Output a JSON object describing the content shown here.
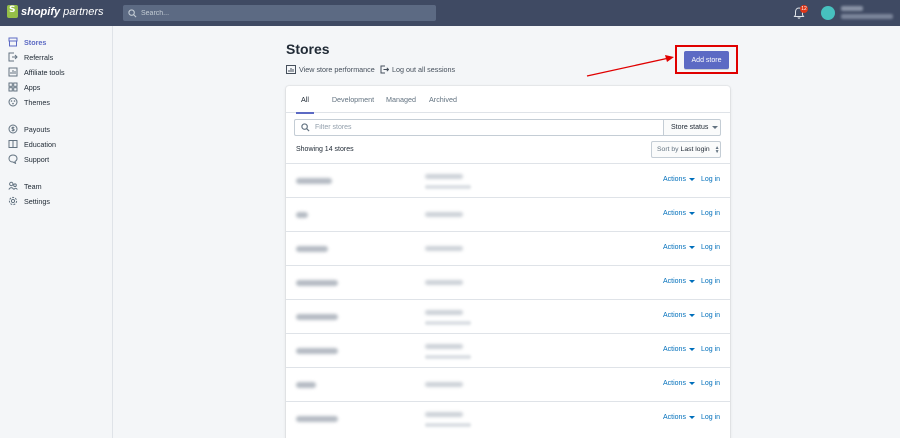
{
  "topbar": {
    "brand_bold": "shopify",
    "brand_light": " partners",
    "search_placeholder": "Search...",
    "notification_count": "12",
    "icons": [
      "shopify-bag-icon",
      "search-icon",
      "bell-icon"
    ]
  },
  "sidebar": {
    "items": [
      {
        "label": "Stores",
        "icon": "store-icon",
        "active": true
      },
      {
        "label": "Referrals",
        "icon": "referral-icon"
      },
      {
        "label": "Affiliate tools",
        "icon": "chart-icon"
      },
      {
        "label": "Apps",
        "icon": "apps-icon"
      },
      {
        "label": "Themes",
        "icon": "themes-icon"
      },
      {
        "label": "Payouts",
        "icon": "payouts-icon"
      },
      {
        "label": "Education",
        "icon": "education-icon"
      },
      {
        "label": "Support",
        "icon": "support-icon"
      },
      {
        "label": "Team",
        "icon": "team-icon"
      },
      {
        "label": "Settings",
        "icon": "settings-icon"
      }
    ]
  },
  "page": {
    "title": "Stores",
    "view_performance": "View store performance",
    "logout_sessions": "Log out all sessions",
    "add_store": "Add store",
    "accent": "#5c6ac4",
    "highlight_color": "#e00000"
  },
  "tabs": [
    "All",
    "Development",
    "Managed",
    "Archived"
  ],
  "filters": {
    "search_placeholder": "Filter stores",
    "store_status": "Store status",
    "showing": "Showing 14 stores",
    "sort_prefix": "Sort by",
    "sort_value": "Last login"
  },
  "rows": [
    {
      "actions": "Actions",
      "login": "Log in"
    },
    {
      "actions": "Actions",
      "login": "Log in"
    },
    {
      "actions": "Actions",
      "login": "Log in"
    },
    {
      "actions": "Actions",
      "login": "Log in"
    },
    {
      "actions": "Actions",
      "login": "Log in"
    },
    {
      "actions": "Actions",
      "login": "Log in"
    },
    {
      "actions": "Actions",
      "login": "Log in"
    },
    {
      "actions": "Actions",
      "login": "Log in"
    }
  ]
}
